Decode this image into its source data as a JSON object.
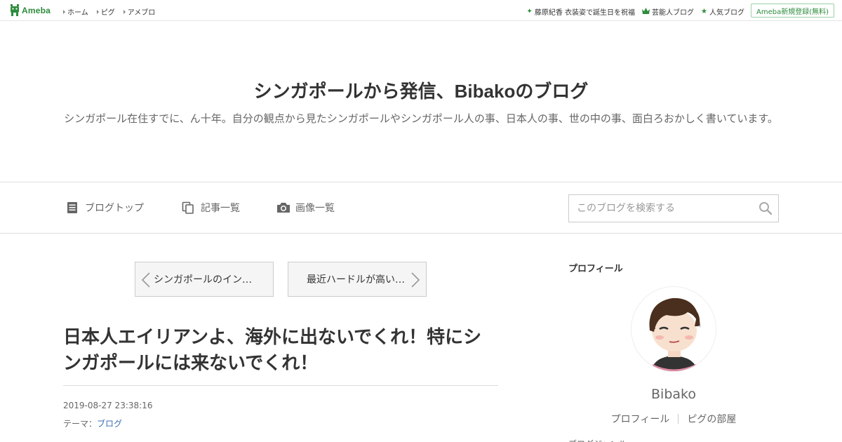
{
  "topbar": {
    "logo_text": "Ameba",
    "nav": [
      {
        "label": "ホーム"
      },
      {
        "label": "ピグ"
      },
      {
        "label": "アメブロ"
      }
    ],
    "right_links": [
      {
        "label": "藤原紀香 衣装姿で誕生日を祝福",
        "icon": "sparkle-icon"
      },
      {
        "label": "芸能人ブログ",
        "icon": "crown-icon"
      },
      {
        "label": "人気ブログ",
        "icon": "star-icon"
      }
    ],
    "signup_label": "Ameba新規登録(無料)"
  },
  "blog": {
    "title": "シンガポールから発信、Bibakoのブログ",
    "description": "シンガポール在住すでに、ん十年。自分の観点から見たシンガポールやシンガポール人の事、日本人の事、世の中の事、面白ろおかしく書いています。"
  },
  "blog_nav": {
    "items": [
      {
        "label": "ブログトップ",
        "icon": "document-icon"
      },
      {
        "label": "記事一覧",
        "icon": "copy-icon"
      },
      {
        "label": "画像一覧",
        "icon": "camera-icon"
      }
    ],
    "search_placeholder": "このブログを検索する"
  },
  "pager": {
    "prev_label": "シンガポールのイン…",
    "next_label": "最近ハードルが高い…"
  },
  "article": {
    "title": "日本人エイリアンよ、海外に出ないでくれ！特にシンガポールには来ないでくれ！",
    "date": "2019-08-27 23:38:16",
    "theme_prefix": "テーマ：",
    "theme_link": "ブログ"
  },
  "sidebar": {
    "heading": "プロフィール",
    "name": "Bibako",
    "links": [
      {
        "label": "プロフィール"
      },
      {
        "label": "ピグの部屋"
      }
    ],
    "cut_text": "ブログジャンル"
  },
  "colors": {
    "brand_green": "#2d8c3c",
    "link_blue": "#3b6eb4"
  }
}
